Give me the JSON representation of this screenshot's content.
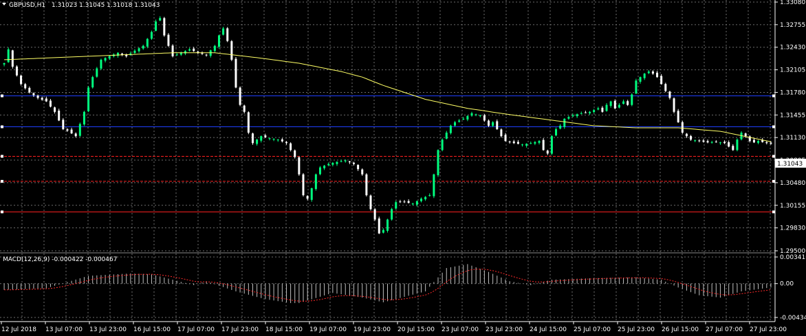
{
  "header": {
    "symbol_label": "GBPUSD,H1",
    "ohlc_label": "1.31023 1.31045 1.31018 1.31043",
    "macd_label": "MACD(12,26,9) -0.000422 -0.000467"
  },
  "colors": {
    "background": "#000000",
    "grid": "#6e6e6e",
    "bull_candle": "#00ff7f",
    "bear_candle": "#ffffff",
    "ma_line": "#ffff66",
    "blue_level": "#1f3fff",
    "red_level": "#ff1f1f",
    "macd_hist": "#c0c0c0",
    "macd_signal": "#ff2a2a",
    "price_tag_bg": "#ffffff",
    "price_tag_text": "#000000"
  },
  "chart_data": [
    {
      "type": "candlestick",
      "timeframe": "H1",
      "x_labels": [
        "12 Jul 2018",
        "13 Jul 07:00",
        "13 Jul 23:00",
        "16 Jul 15:00",
        "17 Jul 07:00",
        "17 Jul 23:00",
        "18 Jul 15:00",
        "19 Jul 07:00",
        "19 Jul 23:00",
        "20 Jul 15:00",
        "23 Jul 07:00",
        "23 Jul 23:00",
        "24 Jul 15:00",
        "25 Jul 07:00",
        "25 Jul 23:00",
        "26 Jul 15:00",
        "27 Jul 07:00",
        "27 Jul 23:00"
      ],
      "y_ticks": [
        "1.33080",
        "1.32755",
        "1.32430",
        "1.32105",
        "1.31780",
        "1.31455",
        "1.31130",
        "1.30805",
        "1.30480",
        "1.30155",
        "1.29830",
        "1.29500"
      ],
      "ylim": [
        1.295,
        1.3308
      ],
      "last_price": "1.31043",
      "close_path": [
        [
          0,
          1.322
        ],
        [
          1,
          1.324
        ],
        [
          2,
          1.3215
        ],
        [
          4,
          1.319
        ],
        [
          6,
          1.3178
        ],
        [
          8,
          1.317
        ],
        [
          10,
          1.3165
        ],
        [
          12,
          1.315
        ],
        [
          14,
          1.3125
        ],
        [
          15,
          1.3123
        ],
        [
          17,
          1.3115
        ],
        [
          19,
          1.315
        ],
        [
          20,
          1.3185
        ],
        [
          21,
          1.32
        ],
        [
          23,
          1.3225
        ],
        [
          25,
          1.323
        ],
        [
          27,
          1.3235
        ],
        [
          29,
          1.323
        ],
        [
          31,
          1.3238
        ],
        [
          33,
          1.3245
        ],
        [
          35,
          1.3265
        ],
        [
          36,
          1.328
        ],
        [
          37,
          1.3285
        ],
        [
          38,
          1.326
        ],
        [
          39,
          1.3245
        ],
        [
          40,
          1.323
        ],
        [
          42,
          1.3235
        ],
        [
          44,
          1.324
        ],
        [
          46,
          1.3235
        ],
        [
          48,
          1.3232
        ],
        [
          50,
          1.3245
        ],
        [
          51,
          1.326
        ],
        [
          52,
          1.327
        ],
        [
          53,
          1.3252
        ],
        [
          54,
          1.3225
        ],
        [
          55,
          1.3185
        ],
        [
          56,
          1.316
        ],
        [
          57,
          1.315
        ],
        [
          58,
          1.312
        ],
        [
          59,
          1.3105
        ],
        [
          61,
          1.3115
        ],
        [
          63,
          1.3112
        ],
        [
          65,
          1.311
        ],
        [
          67,
          1.3105
        ],
        [
          69,
          1.3085
        ],
        [
          70,
          1.306
        ],
        [
          71,
          1.303
        ],
        [
          72,
          1.3025
        ],
        [
          73,
          1.304
        ],
        [
          74,
          1.306
        ],
        [
          75,
          1.307
        ],
        [
          77,
          1.3075
        ],
        [
          79,
          1.3078
        ],
        [
          81,
          1.308
        ],
        [
          83,
          1.3075
        ],
        [
          85,
          1.306
        ],
        [
          86,
          1.303
        ],
        [
          87,
          1.301
        ],
        [
          88,
          1.2995
        ],
        [
          89,
          1.2975
        ],
        [
          90,
          1.298
        ],
        [
          91,
          1.2995
        ],
        [
          92,
          1.301
        ],
        [
          93,
          1.302
        ],
        [
          95,
          1.302
        ],
        [
          97,
          1.3018
        ],
        [
          99,
          1.3025
        ],
        [
          101,
          1.303
        ],
        [
          102,
          1.306
        ],
        [
          103,
          1.3095
        ],
        [
          104,
          1.311
        ],
        [
          105,
          1.312
        ],
        [
          106,
          1.313
        ],
        [
          107,
          1.3135
        ],
        [
          109,
          1.314
        ],
        [
          111,
          1.3148
        ],
        [
          113,
          1.3145
        ],
        [
          115,
          1.313
        ],
        [
          116,
          1.3135
        ],
        [
          117,
          1.3125
        ],
        [
          118,
          1.3115
        ],
        [
          119,
          1.3108
        ],
        [
          121,
          1.3105
        ],
        [
          123,
          1.3103
        ],
        [
          125,
          1.3105
        ],
        [
          127,
          1.3108
        ],
        [
          128,
          1.3095
        ],
        [
          129,
          1.309
        ],
        [
          130,
          1.3115
        ],
        [
          131,
          1.3125
        ],
        [
          132,
          1.313
        ],
        [
          133,
          1.314
        ],
        [
          135,
          1.3145
        ],
        [
          137,
          1.3148
        ],
        [
          139,
          1.315
        ],
        [
          141,
          1.3155
        ],
        [
          142,
          1.315
        ],
        [
          143,
          1.316
        ],
        [
          144,
          1.3165
        ],
        [
          145,
          1.3155
        ],
        [
          146,
          1.316
        ],
        [
          147,
          1.3165
        ],
        [
          148,
          1.316
        ],
        [
          149,
          1.3175
        ],
        [
          150,
          1.3195
        ],
        [
          151,
          1.32
        ],
        [
          152,
          1.3205
        ],
        [
          153,
          1.3208
        ],
        [
          154,
          1.3205
        ],
        [
          155,
          1.32
        ],
        [
          156,
          1.319
        ],
        [
          157,
          1.318
        ],
        [
          158,
          1.317
        ],
        [
          159,
          1.315
        ],
        [
          160,
          1.3135
        ],
        [
          161,
          1.312
        ],
        [
          162,
          1.3115
        ],
        [
          163,
          1.311
        ],
        [
          165,
          1.3108
        ],
        [
          167,
          1.3106
        ],
        [
          169,
          1.3107
        ],
        [
          171,
          1.3105
        ],
        [
          172,
          1.31
        ],
        [
          173,
          1.3095
        ],
        [
          174,
          1.311
        ],
        [
          175,
          1.312
        ],
        [
          176,
          1.3115
        ],
        [
          177,
          1.3108
        ],
        [
          178,
          1.3106
        ],
        [
          179,
          1.3108
        ],
        [
          181,
          1.3105
        ],
        [
          182,
          1.3104
        ]
      ],
      "ma_path": [
        [
          0,
          1.3225
        ],
        [
          20,
          1.323
        ],
        [
          40,
          1.3235
        ],
        [
          50,
          1.3235
        ],
        [
          60,
          1.3228
        ],
        [
          70,
          1.322
        ],
        [
          80,
          1.3208
        ],
        [
          85,
          1.32
        ],
        [
          90,
          1.3188
        ],
        [
          100,
          1.3168
        ],
        [
          110,
          1.3155
        ],
        [
          120,
          1.3146
        ],
        [
          130,
          1.3138
        ],
        [
          140,
          1.313
        ],
        [
          150,
          1.3127
        ],
        [
          160,
          1.3127
        ],
        [
          170,
          1.3122
        ],
        [
          182,
          1.3107
        ]
      ],
      "horizontal_levels": [
        {
          "price": 1.3173,
          "color": "blue",
          "style": "solid"
        },
        {
          "price": 1.31285,
          "color": "blue",
          "style": "solid"
        },
        {
          "price": 1.3086,
          "color": "red",
          "style": "dashed"
        },
        {
          "price": 1.305,
          "color": "red",
          "style": "dashed"
        },
        {
          "price": 1.3006,
          "color": "red",
          "style": "solid"
        }
      ]
    },
    {
      "type": "bar",
      "indicator": "MACD(12,26,9)",
      "y_ticks": [
        "0.003416",
        "0.00",
        "-0.004345"
      ],
      "ylim": [
        -0.004345,
        0.003416
      ],
      "hist_path": [
        [
          0,
          -0.0008
        ],
        [
          10,
          -0.0006
        ],
        [
          20,
          0.001
        ],
        [
          30,
          0.0013
        ],
        [
          35,
          0.0012
        ],
        [
          40,
          0.0005
        ],
        [
          45,
          -0.0002
        ],
        [
          48,
          0.0003
        ],
        [
          55,
          -0.001
        ],
        [
          62,
          -0.002
        ],
        [
          68,
          -0.0025
        ],
        [
          70,
          -0.0025
        ],
        [
          78,
          -0.0012
        ],
        [
          85,
          -0.0018
        ],
        [
          90,
          -0.0024
        ],
        [
          100,
          -0.001
        ],
        [
          105,
          0.002
        ],
        [
          110,
          0.0025
        ],
        [
          115,
          0.0015
        ],
        [
          120,
          0.0003
        ],
        [
          125,
          -0.0002
        ],
        [
          130,
          0.0005
        ],
        [
          140,
          0.0007
        ],
        [
          150,
          0.0008
        ],
        [
          156,
          0.0005
        ],
        [
          160,
          -0.0005
        ],
        [
          165,
          -0.0015
        ],
        [
          170,
          -0.0018
        ],
        [
          175,
          -0.001
        ],
        [
          182,
          -0.0005
        ]
      ]
    }
  ]
}
